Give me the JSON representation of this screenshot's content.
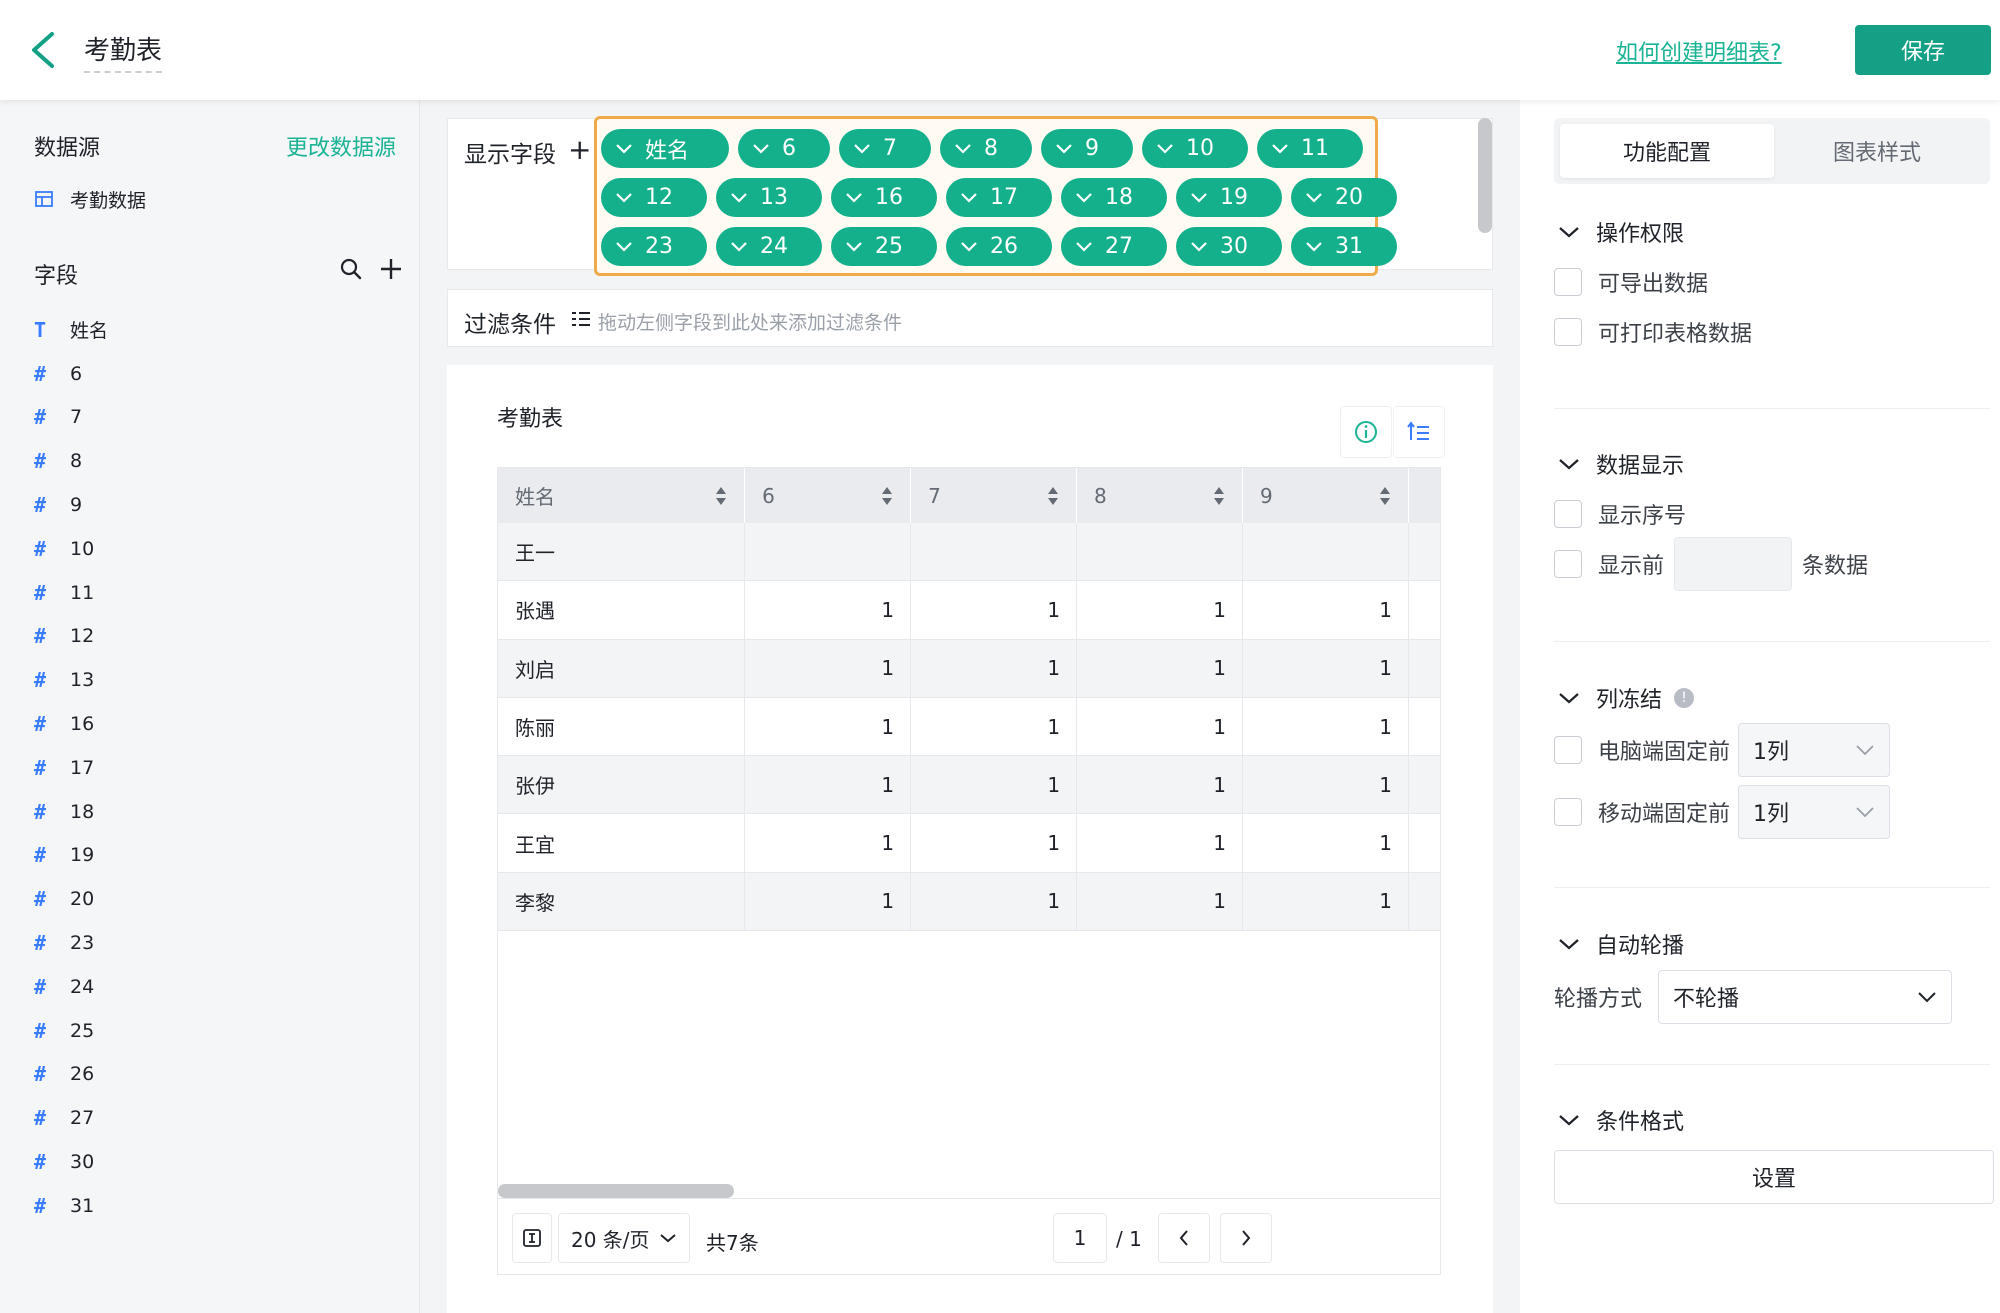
{
  "header": {
    "title": "考勤表",
    "help_link": "如何创建明细表?",
    "save_label": "保存"
  },
  "sidebar": {
    "datasource_title": "数据源",
    "change_datasource": "更改数据源",
    "datasource_name": "考勤数据",
    "fields_title": "字段",
    "fields": [
      {
        "type": "T",
        "name": "姓名"
      },
      {
        "type": "#",
        "name": "6"
      },
      {
        "type": "#",
        "name": "7"
      },
      {
        "type": "#",
        "name": "8"
      },
      {
        "type": "#",
        "name": "9"
      },
      {
        "type": "#",
        "name": "10"
      },
      {
        "type": "#",
        "name": "11"
      },
      {
        "type": "#",
        "name": "12"
      },
      {
        "type": "#",
        "name": "13"
      },
      {
        "type": "#",
        "name": "16"
      },
      {
        "type": "#",
        "name": "17"
      },
      {
        "type": "#",
        "name": "18"
      },
      {
        "type": "#",
        "name": "19"
      },
      {
        "type": "#",
        "name": "20"
      },
      {
        "type": "#",
        "name": "23"
      },
      {
        "type": "#",
        "name": "24"
      },
      {
        "type": "#",
        "name": "25"
      },
      {
        "type": "#",
        "name": "26"
      },
      {
        "type": "#",
        "name": "27"
      },
      {
        "type": "#",
        "name": "30"
      },
      {
        "type": "#",
        "name": "31"
      }
    ]
  },
  "display_fields": {
    "label": "显示字段",
    "chips": [
      "姓名",
      "6",
      "7",
      "8",
      "9",
      "10",
      "11",
      "12",
      "13",
      "16",
      "17",
      "18",
      "19",
      "20",
      "23",
      "24",
      "25",
      "26",
      "27",
      "30",
      "31"
    ]
  },
  "filter": {
    "label": "过滤条件",
    "hint": "拖动左侧字段到此处来添加过滤条件"
  },
  "table": {
    "title": "考勤表",
    "columns": [
      "姓名",
      "6",
      "7",
      "8",
      "9"
    ],
    "rows": [
      [
        "王一",
        "",
        "",
        "",
        ""
      ],
      [
        "张遇",
        "1",
        "1",
        "1",
        "1"
      ],
      [
        "刘启",
        "1",
        "1",
        "1",
        "1"
      ],
      [
        "陈丽",
        "1",
        "1",
        "1",
        "1"
      ],
      [
        "张伊",
        "1",
        "1",
        "1",
        "1"
      ],
      [
        "王宜",
        "1",
        "1",
        "1",
        "1"
      ],
      [
        "李黎",
        "1",
        "1",
        "1",
        "1"
      ]
    ],
    "pager": {
      "page_size": "20 条/页",
      "total": "共7条",
      "current_page": "1",
      "total_pages": "/ 1"
    }
  },
  "right_panel": {
    "tabs": [
      "功能配置",
      "图表样式"
    ],
    "active_tab": 0,
    "permissions": {
      "title": "操作权限",
      "options": [
        "可导出数据",
        "可打印表格数据"
      ]
    },
    "data_display": {
      "title": "数据显示",
      "show_index": "显示序号",
      "show_first_prefix": "显示前",
      "show_first_suffix": "条数据"
    },
    "freeze": {
      "title": "列冻结",
      "info": "!",
      "pc_label": "电脑端固定前",
      "pc_value": "1列",
      "mobile_label": "移动端固定前",
      "mobile_value": "1列"
    },
    "carousel": {
      "title": "自动轮播",
      "mode_label": "轮播方式",
      "mode_value": "不轮播"
    },
    "conditional": {
      "title": "条件格式",
      "button": "设置"
    }
  },
  "colors": {
    "accent": "#14a085",
    "chip": "#14b08b",
    "highlight_border": "#f0a94b",
    "field_icon": "#3a7cff"
  }
}
